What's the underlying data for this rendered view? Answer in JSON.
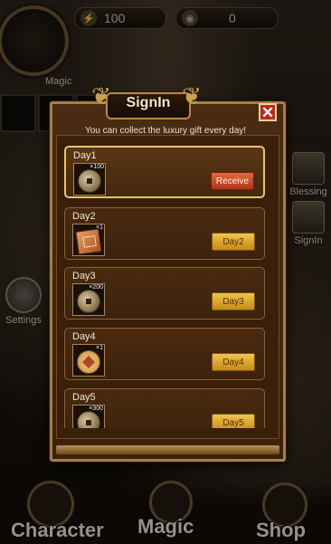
{
  "hud": {
    "energy_value": "100",
    "coins_value": "0",
    "magic_label": "Magic"
  },
  "side": {
    "blessing_label": "Blessing",
    "signin_label": "SignIn",
    "settings_label": "Settings"
  },
  "nav": {
    "character": "Character",
    "magic": "Magic",
    "shop": "Shop"
  },
  "dialog": {
    "title": "SignIn",
    "close": "✕",
    "subtitle": "You can collect the luxury gift every day!",
    "days": [
      {
        "day": "Day1",
        "qty": "×100",
        "item": "coin-icon",
        "button": "Receive",
        "state": "claimable"
      },
      {
        "day": "Day2",
        "qty": "×1",
        "item": "book-icon",
        "button": "Day2",
        "state": "locked"
      },
      {
        "day": "Day3",
        "qty": "×200",
        "item": "coin-icon",
        "button": "Day3",
        "state": "locked"
      },
      {
        "day": "Day4",
        "qty": "×1",
        "item": "seal-icon",
        "button": "Day4",
        "state": "locked"
      },
      {
        "day": "Day5",
        "qty": "×300",
        "item": "coin-icon",
        "button": "Day5",
        "state": "locked"
      }
    ]
  },
  "colors": {
    "receive_button": "#c8482a",
    "day_button": "#e2ad2e",
    "frame_gold": "#a57e42"
  }
}
